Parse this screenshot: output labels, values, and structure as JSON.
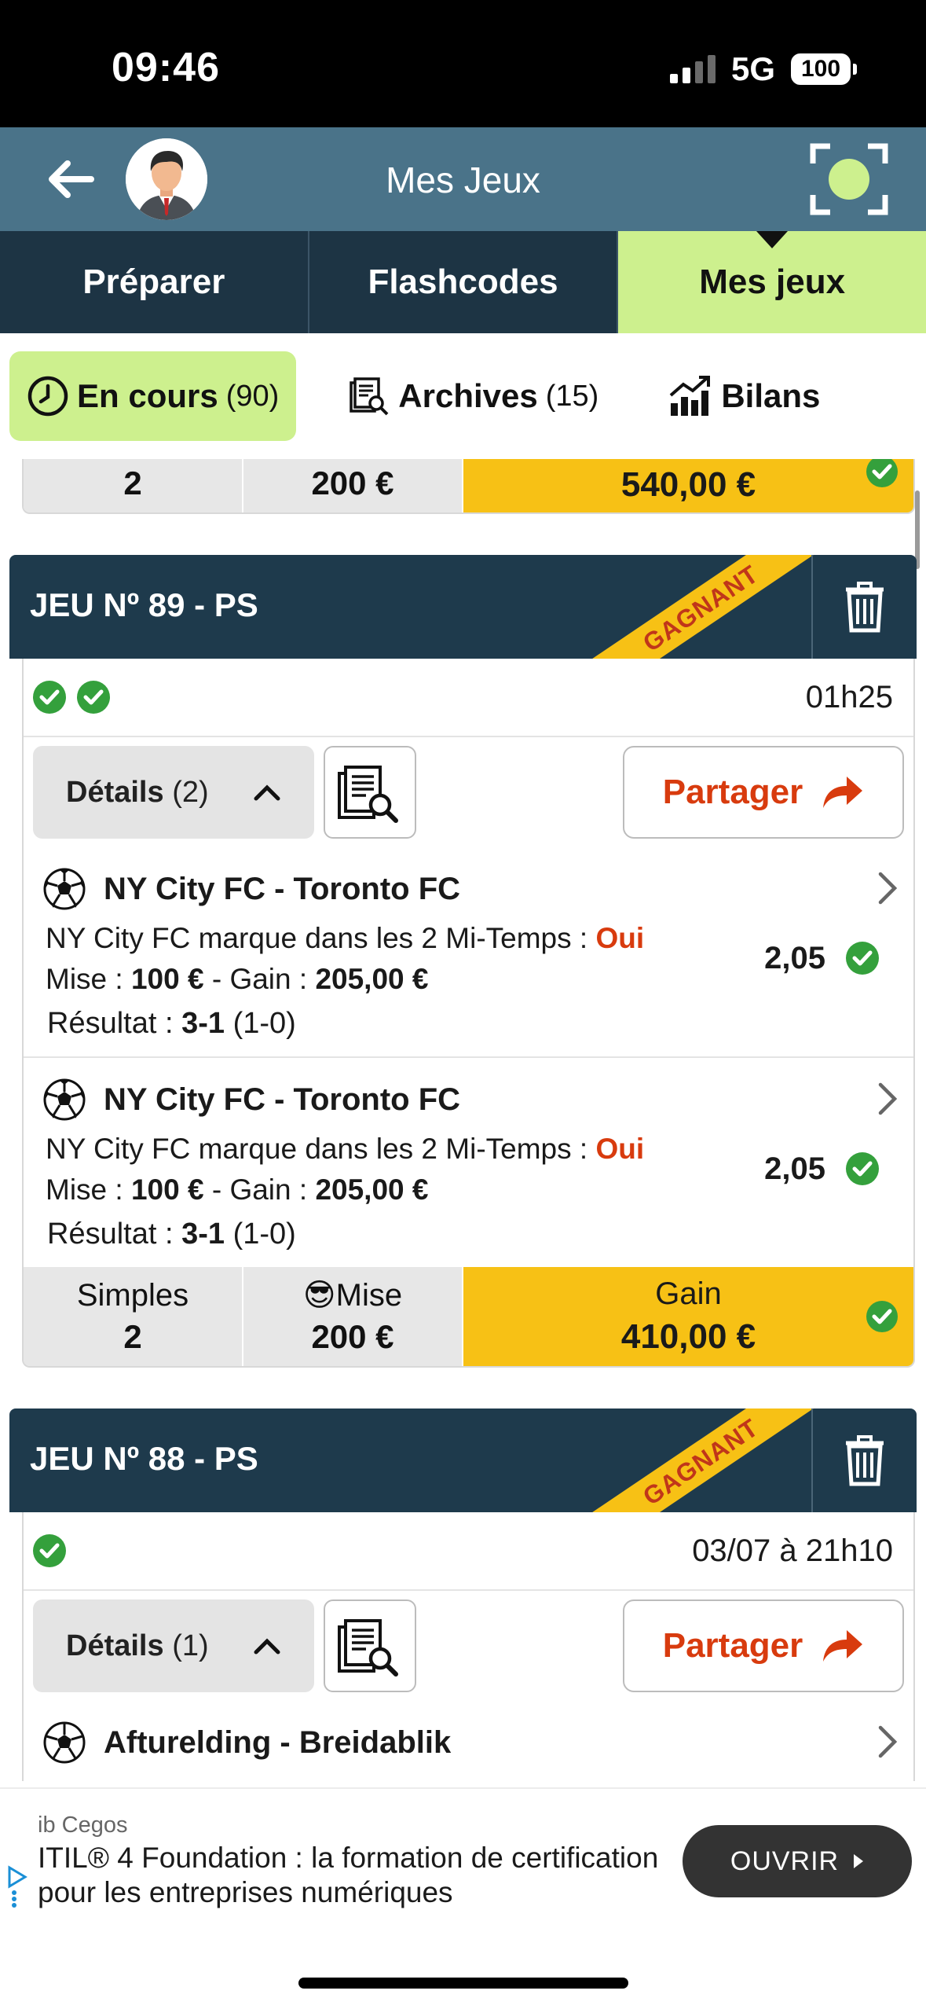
{
  "status_bar": {
    "time": "09:46",
    "network": "5G",
    "battery": "100"
  },
  "header": {
    "title": "Mes Jeux"
  },
  "main_tabs": [
    {
      "label": "Préparer"
    },
    {
      "label": "Flashcodes"
    },
    {
      "label": "Mes jeux"
    }
  ],
  "sub_tabs": [
    {
      "label": "En cours",
      "count": "(90)"
    },
    {
      "label": "Archives",
      "count": "(15)"
    },
    {
      "label": "Bilans",
      "count": ""
    }
  ],
  "prev_summary": {
    "count": "2",
    "mise": "200 €",
    "gain": "540,00 €"
  },
  "games": [
    {
      "title": "JEU Nº 89 - PS",
      "badge": "GAGNANT",
      "time": "01h25",
      "details_label": "Détails",
      "details_count": "(2)",
      "share_label": "Partager",
      "bets": [
        {
          "match": "NY City FC - Toronto FC",
          "selection": "NY City FC marque dans les 2 Mi-Temps :",
          "choice": "Oui",
          "mise_label": "Mise :",
          "mise_value": "100 €",
          "gain_label": "- Gain :",
          "gain_value": "205,00 €",
          "odds": "2,05",
          "result_label": "Résultat :",
          "result_score": "3-1",
          "result_half": "(1-0)"
        },
        {
          "match": "NY City FC - Toronto FC",
          "selection": "NY City FC marque dans les 2 Mi-Temps :",
          "choice": "Oui",
          "mise_label": "Mise :",
          "mise_value": "100 €",
          "gain_label": "- Gain :",
          "gain_value": "205,00 €",
          "odds": "2,05",
          "result_label": "Résultat :",
          "result_score": "3-1",
          "result_half": "(1-0)"
        }
      ],
      "summary": {
        "type_label": "Simples",
        "count": "2",
        "mise_label": "Mise",
        "mise_emoji": "😎",
        "mise": "200 €",
        "gain_label": "Gain",
        "gain": "410,00 €"
      }
    },
    {
      "title": "JEU Nº 88 - PS",
      "badge": "GAGNANT",
      "time": "03/07 à 21h10",
      "details_label": "Détails",
      "details_count": "(1)",
      "share_label": "Partager",
      "bets": [
        {
          "match": "Afturelding - Breidablik"
        }
      ]
    }
  ],
  "ad": {
    "sponsor": "ib Cegos",
    "text": "ITIL® 4 Foundation : la formation de certification pour les entreprises numériques",
    "button": "OUVRIR"
  },
  "colors": {
    "header_bg": "#4a7389",
    "tabs_bg": "#1d3444",
    "active_tab": "#cdf08e",
    "game_header": "#1e3a4c",
    "gain_yellow": "#f7c115",
    "accent_orange": "#d83b0e",
    "check_green": "#34a03c"
  }
}
